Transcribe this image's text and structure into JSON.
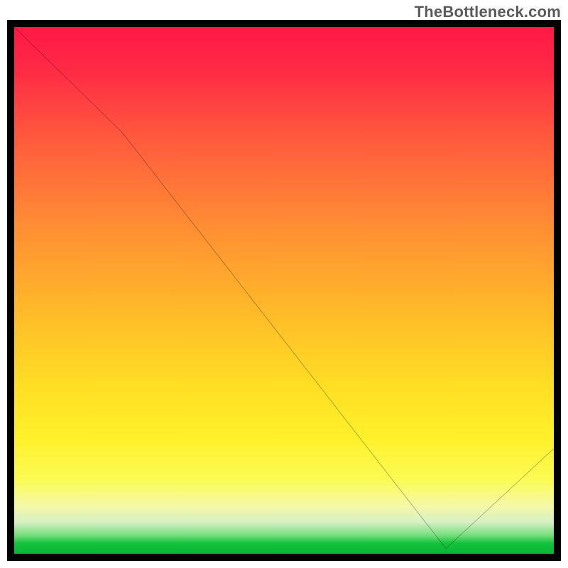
{
  "attribution": "TheBottleneck.com",
  "chart_data": {
    "type": "line",
    "title": "",
    "xlabel": "",
    "ylabel": "",
    "xlim": [
      0,
      100
    ],
    "ylim": [
      0,
      100
    ],
    "grid": false,
    "x": [
      0,
      20,
      80,
      100
    ],
    "values": [
      100,
      80,
      1,
      20
    ],
    "annotations": [
      {
        "text": "",
        "x": 80,
        "y": 1
      }
    ],
    "notes": "Background is a vertical red→yellow→green heat gradient indicating bottleneck severity; black polyline shows bottleneck % vs an unlabeled x-axis. No axis ticks or labels are rendered in the image."
  },
  "labels": {
    "min_badge": ""
  },
  "colors": {
    "border": "#000000",
    "curve": "#000000",
    "attribution": "#5b5b5b",
    "min_badge": "#e0262a",
    "gradient_top": "#ff1846",
    "gradient_mid": "#ffde24",
    "gradient_bottom": "#0ab536"
  }
}
